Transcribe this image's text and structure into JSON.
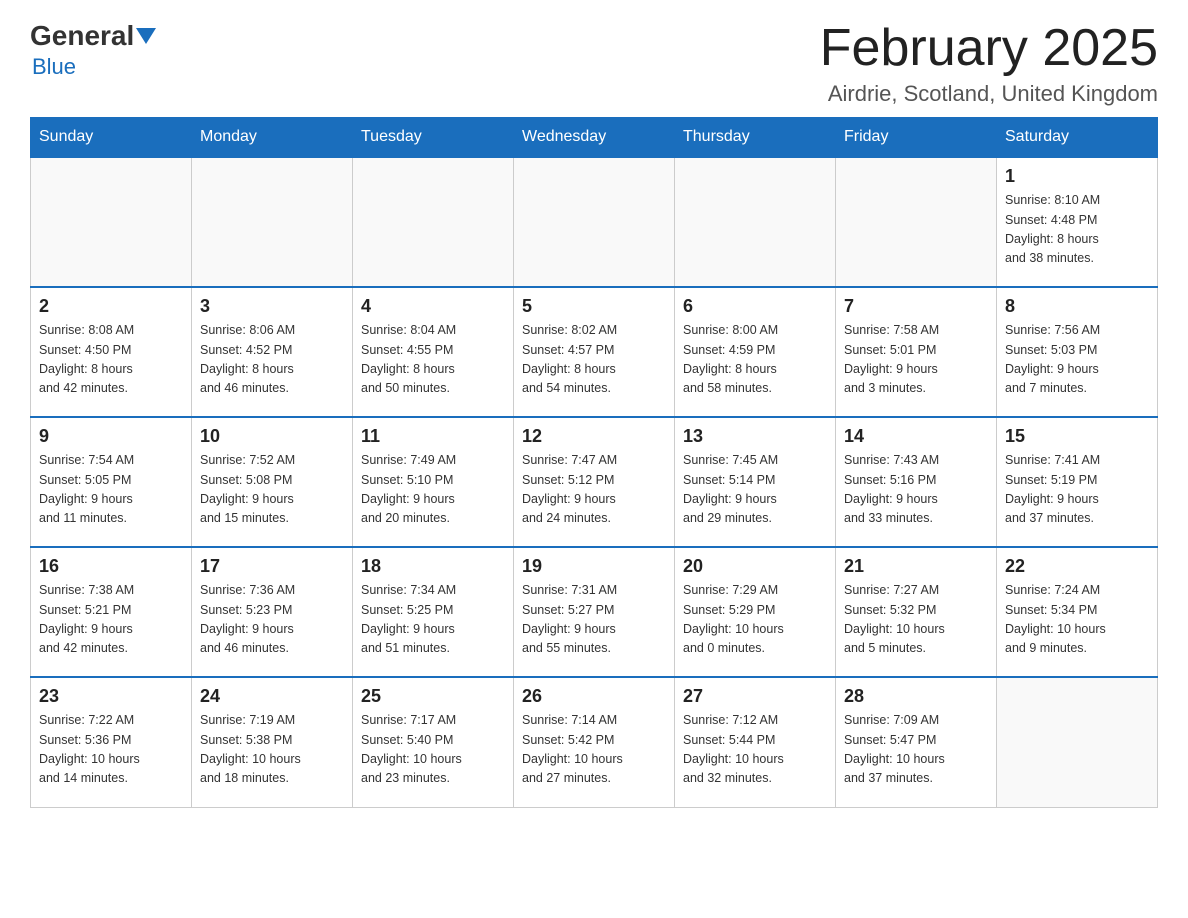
{
  "header": {
    "logo_general": "General",
    "logo_blue": "Blue",
    "month_title": "February 2025",
    "location": "Airdrie, Scotland, United Kingdom"
  },
  "weekdays": [
    "Sunday",
    "Monday",
    "Tuesday",
    "Wednesday",
    "Thursday",
    "Friday",
    "Saturday"
  ],
  "weeks": [
    [
      {
        "day": "",
        "info": ""
      },
      {
        "day": "",
        "info": ""
      },
      {
        "day": "",
        "info": ""
      },
      {
        "day": "",
        "info": ""
      },
      {
        "day": "",
        "info": ""
      },
      {
        "day": "",
        "info": ""
      },
      {
        "day": "1",
        "info": "Sunrise: 8:10 AM\nSunset: 4:48 PM\nDaylight: 8 hours\nand 38 minutes."
      }
    ],
    [
      {
        "day": "2",
        "info": "Sunrise: 8:08 AM\nSunset: 4:50 PM\nDaylight: 8 hours\nand 42 minutes."
      },
      {
        "day": "3",
        "info": "Sunrise: 8:06 AM\nSunset: 4:52 PM\nDaylight: 8 hours\nand 46 minutes."
      },
      {
        "day": "4",
        "info": "Sunrise: 8:04 AM\nSunset: 4:55 PM\nDaylight: 8 hours\nand 50 minutes."
      },
      {
        "day": "5",
        "info": "Sunrise: 8:02 AM\nSunset: 4:57 PM\nDaylight: 8 hours\nand 54 minutes."
      },
      {
        "day": "6",
        "info": "Sunrise: 8:00 AM\nSunset: 4:59 PM\nDaylight: 8 hours\nand 58 minutes."
      },
      {
        "day": "7",
        "info": "Sunrise: 7:58 AM\nSunset: 5:01 PM\nDaylight: 9 hours\nand 3 minutes."
      },
      {
        "day": "8",
        "info": "Sunrise: 7:56 AM\nSunset: 5:03 PM\nDaylight: 9 hours\nand 7 minutes."
      }
    ],
    [
      {
        "day": "9",
        "info": "Sunrise: 7:54 AM\nSunset: 5:05 PM\nDaylight: 9 hours\nand 11 minutes."
      },
      {
        "day": "10",
        "info": "Sunrise: 7:52 AM\nSunset: 5:08 PM\nDaylight: 9 hours\nand 15 minutes."
      },
      {
        "day": "11",
        "info": "Sunrise: 7:49 AM\nSunset: 5:10 PM\nDaylight: 9 hours\nand 20 minutes."
      },
      {
        "day": "12",
        "info": "Sunrise: 7:47 AM\nSunset: 5:12 PM\nDaylight: 9 hours\nand 24 minutes."
      },
      {
        "day": "13",
        "info": "Sunrise: 7:45 AM\nSunset: 5:14 PM\nDaylight: 9 hours\nand 29 minutes."
      },
      {
        "day": "14",
        "info": "Sunrise: 7:43 AM\nSunset: 5:16 PM\nDaylight: 9 hours\nand 33 minutes."
      },
      {
        "day": "15",
        "info": "Sunrise: 7:41 AM\nSunset: 5:19 PM\nDaylight: 9 hours\nand 37 minutes."
      }
    ],
    [
      {
        "day": "16",
        "info": "Sunrise: 7:38 AM\nSunset: 5:21 PM\nDaylight: 9 hours\nand 42 minutes."
      },
      {
        "day": "17",
        "info": "Sunrise: 7:36 AM\nSunset: 5:23 PM\nDaylight: 9 hours\nand 46 minutes."
      },
      {
        "day": "18",
        "info": "Sunrise: 7:34 AM\nSunset: 5:25 PM\nDaylight: 9 hours\nand 51 minutes."
      },
      {
        "day": "19",
        "info": "Sunrise: 7:31 AM\nSunset: 5:27 PM\nDaylight: 9 hours\nand 55 minutes."
      },
      {
        "day": "20",
        "info": "Sunrise: 7:29 AM\nSunset: 5:29 PM\nDaylight: 10 hours\nand 0 minutes."
      },
      {
        "day": "21",
        "info": "Sunrise: 7:27 AM\nSunset: 5:32 PM\nDaylight: 10 hours\nand 5 minutes."
      },
      {
        "day": "22",
        "info": "Sunrise: 7:24 AM\nSunset: 5:34 PM\nDaylight: 10 hours\nand 9 minutes."
      }
    ],
    [
      {
        "day": "23",
        "info": "Sunrise: 7:22 AM\nSunset: 5:36 PM\nDaylight: 10 hours\nand 14 minutes."
      },
      {
        "day": "24",
        "info": "Sunrise: 7:19 AM\nSunset: 5:38 PM\nDaylight: 10 hours\nand 18 minutes."
      },
      {
        "day": "25",
        "info": "Sunrise: 7:17 AM\nSunset: 5:40 PM\nDaylight: 10 hours\nand 23 minutes."
      },
      {
        "day": "26",
        "info": "Sunrise: 7:14 AM\nSunset: 5:42 PM\nDaylight: 10 hours\nand 27 minutes."
      },
      {
        "day": "27",
        "info": "Sunrise: 7:12 AM\nSunset: 5:44 PM\nDaylight: 10 hours\nand 32 minutes."
      },
      {
        "day": "28",
        "info": "Sunrise: 7:09 AM\nSunset: 5:47 PM\nDaylight: 10 hours\nand 37 minutes."
      },
      {
        "day": "",
        "info": ""
      }
    ]
  ]
}
